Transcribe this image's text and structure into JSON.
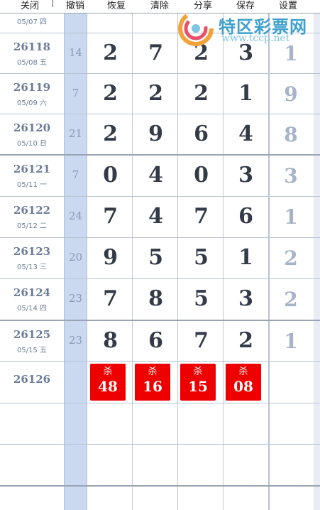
{
  "toolbar": {
    "close": "关闭",
    "undo": "撤销",
    "restore": "恢复",
    "clear": "清除",
    "share": "分享",
    "save": "保存",
    "settings": "设置"
  },
  "logo": {
    "name": "特区彩票网",
    "url": "www.tccp.net"
  },
  "partial_row": {
    "date": "05/07 四"
  },
  "rows": [
    {
      "issue": "26118",
      "date": "05/08 五",
      "sum": "14",
      "d1": "2",
      "d2": "7",
      "d3": "2",
      "d4": "3",
      "last": "1"
    },
    {
      "issue": "26119",
      "date": "05/09 六",
      "sum": "7",
      "d1": "2",
      "d2": "2",
      "d3": "2",
      "d4": "1",
      "last": "9"
    },
    {
      "issue": "26120",
      "date": "05/10 日",
      "sum": "21",
      "d1": "2",
      "d2": "9",
      "d3": "6",
      "d4": "4",
      "last": "8"
    },
    {
      "issue": "26121",
      "date": "05/11 一",
      "sum": "7",
      "d1": "0",
      "d2": "4",
      "d3": "0",
      "d4": "3",
      "last": "3"
    },
    {
      "issue": "26122",
      "date": "05/12 二",
      "sum": "24",
      "d1": "7",
      "d2": "4",
      "d3": "7",
      "d4": "6",
      "last": "1"
    },
    {
      "issue": "26123",
      "date": "05/13 三",
      "sum": "20",
      "d1": "9",
      "d2": "5",
      "d3": "5",
      "d4": "1",
      "last": "2"
    },
    {
      "issue": "26124",
      "date": "05/14 四",
      "sum": "23",
      "d1": "7",
      "d2": "8",
      "d3": "5",
      "d4": "3",
      "last": "2"
    },
    {
      "issue": "26125",
      "date": "05/15 五",
      "sum": "23",
      "d1": "8",
      "d2": "6",
      "d3": "7",
      "d4": "2",
      "last": "1"
    }
  ],
  "next": {
    "issue": "26126",
    "kills": [
      {
        "label": "杀",
        "value": "48"
      },
      {
        "label": "杀",
        "value": "16"
      },
      {
        "label": "杀",
        "value": "15"
      },
      {
        "label": "杀",
        "value": "08"
      }
    ]
  },
  "colors": {
    "kill_bg": "#ee0000",
    "sum_column": "#cad9f0",
    "logo": "#3fa0cc"
  }
}
